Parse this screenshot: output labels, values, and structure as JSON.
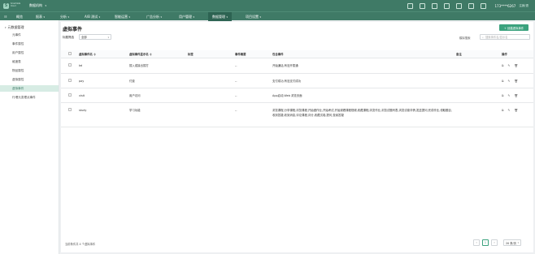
{
  "app": {
    "brand_mark": "S",
    "brand_text": "Smartdata Cloud",
    "org": "数据机构"
  },
  "topbar": {
    "phone": "173****6267",
    "logout": "注销/退",
    "icons": [
      "doc-icon",
      "clipboard-icon",
      "grid-icon",
      "book-icon",
      "phone-icon",
      "tablet-icon",
      "mobile-icon"
    ]
  },
  "nav": [
    {
      "label": "概览",
      "caret": ""
    },
    {
      "label": "报表",
      "caret": "▾"
    },
    {
      "label": "分析",
      "caret": "▾"
    },
    {
      "label": "A/B 测试",
      "caret": "▾"
    },
    {
      "label": "智能运营",
      "caret": "▾"
    },
    {
      "label": "广告分析",
      "caret": "▾"
    },
    {
      "label": "用户管理",
      "caret": "▾"
    },
    {
      "label": "数据管理",
      "caret": "▾"
    },
    {
      "label": "项目设置",
      "caret": "▾"
    }
  ],
  "sidebar": {
    "header": "元数据管理",
    "items": [
      {
        "label": "元事件"
      },
      {
        "label": "事件属性"
      },
      {
        "label": "用户属性"
      },
      {
        "label": "维度表"
      },
      {
        "label": "物品属性"
      },
      {
        "label": "虚拟属性"
      },
      {
        "label": "虚拟事件"
      },
      {
        "label": "行埋元变理点事件"
      }
    ]
  },
  "main": {
    "title": "虚拟事件",
    "add_button": "+ 创建虚拟事件",
    "filter_label": "标题筛选",
    "filter_value": "全部",
    "search_label": "模拟搜索",
    "search_placeholder": "搜索事件名/显示名",
    "columns": [
      "虚拟事件名 ≑",
      "虚拟事件显示名 ≑",
      "标签",
      "事件概要",
      "包含事件",
      "备注",
      "操作"
    ],
    "rows": [
      {
        "name": "tel",
        "display": "拨入或接出拨打",
        "tag": "",
        "summary": "--",
        "events": "开始通话,有没开拨通",
        "note": ""
      },
      {
        "name": "pay",
        "display": "付费",
        "tag": "",
        "summary": "--",
        "events": "支付成功,有没支付成功",
        "note": ""
      },
      {
        "name": "visit",
        "display": "用户访问",
        "tag": "",
        "summary": "--",
        "events": "App启动,Web 浏览页面",
        "note": ""
      },
      {
        "name": "study",
        "display": "学习功能",
        "tag": "",
        "summary": "--",
        "events": "浏览课程,分享课程,浏览课程,开始做作业,开始考试,开始观看课程视频,收藏课程,浏览作业,浏览试题列表,浏览试卷详情,发送提问,完成作业,领取题目,收到答疑,收到消息,评论课程,评分,收藏试卷,提问,查阅答疑",
        "note": ""
      }
    ],
    "footer": "当前条件共 4 个虚拟事件",
    "pager": {
      "prev": "‹",
      "page": "1",
      "next": "›",
      "page_size": "20 条/页"
    }
  }
}
